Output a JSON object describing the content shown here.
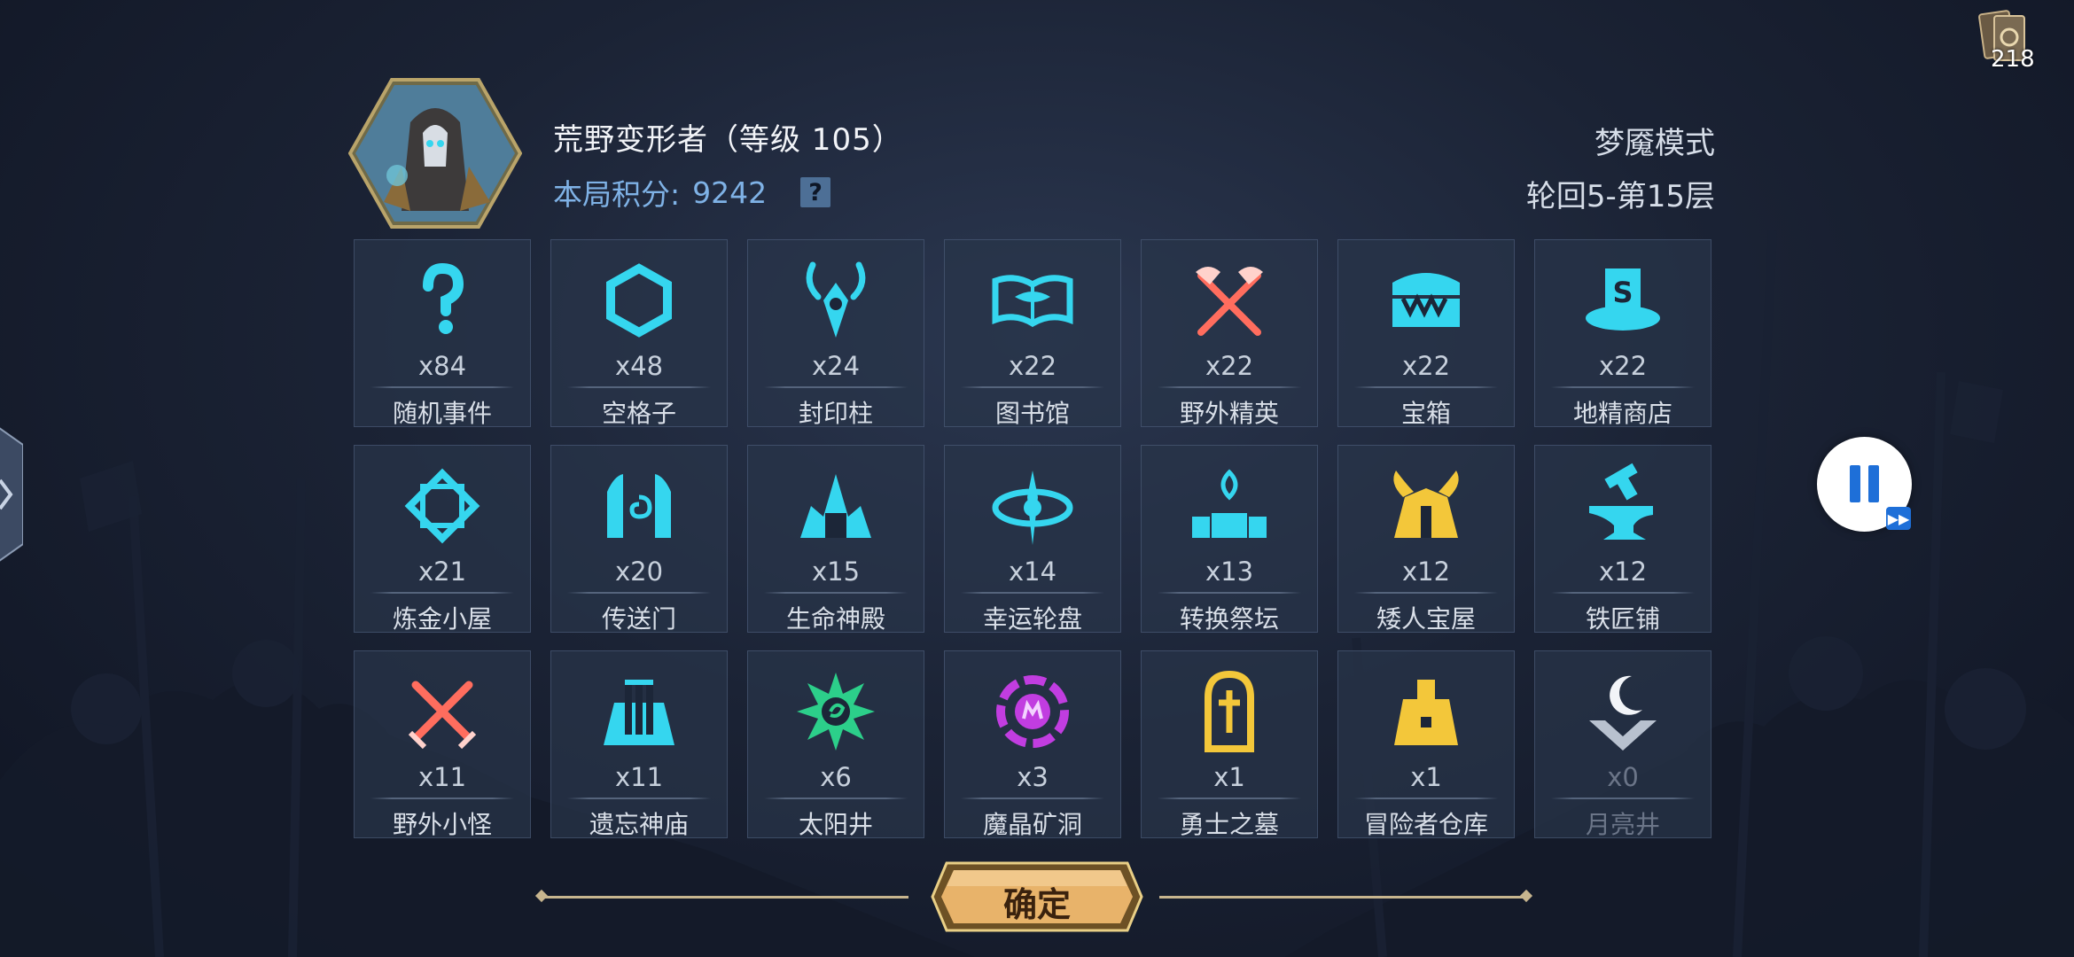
{
  "hero": {
    "name": "荒野变形者（等级 105）",
    "score_label": "本局积分:",
    "score_value": "9242",
    "help_symbol": "?"
  },
  "mode": {
    "title": "梦魇模式",
    "progress": "轮回5-第15层"
  },
  "deck": {
    "count": "218"
  },
  "colors": {
    "cyan": "#35d6ef",
    "gold": "#f3c73a",
    "red": "#ff6d5e",
    "purple": "#c13de0",
    "green": "#2ccf8a",
    "white": "#f2f4f8"
  },
  "tiles": [
    {
      "icon": "question-icon",
      "count": "x84",
      "label": "随机事件"
    },
    {
      "icon": "hexagon-icon",
      "count": "x48",
      "label": "空格子"
    },
    {
      "icon": "seal-pillar-icon",
      "count": "x24",
      "label": "封印柱"
    },
    {
      "icon": "open-book-icon",
      "count": "x22",
      "label": "图书馆"
    },
    {
      "icon": "crossed-axes-icon",
      "count": "x22",
      "label": "野外精英"
    },
    {
      "icon": "treasure-chest-icon",
      "count": "x22",
      "label": "宝箱"
    },
    {
      "icon": "goblin-shop-icon",
      "count": "x22",
      "label": "地精商店"
    },
    {
      "icon": "alchemy-hut-icon",
      "count": "x21",
      "label": "炼金小屋"
    },
    {
      "icon": "portal-icon",
      "count": "x20",
      "label": "传送门"
    },
    {
      "icon": "life-temple-icon",
      "count": "x15",
      "label": "生命神殿"
    },
    {
      "icon": "lucky-wheel-icon",
      "count": "x14",
      "label": "幸运轮盘"
    },
    {
      "icon": "transform-altar-icon",
      "count": "x13",
      "label": "转换祭坛"
    },
    {
      "icon": "dwarf-treasury-icon",
      "count": "x12",
      "label": "矮人宝屋"
    },
    {
      "icon": "anvil-icon",
      "count": "x12",
      "label": "铁匠铺"
    },
    {
      "icon": "crossed-swords-icon",
      "count": "x11",
      "label": "野外小怪"
    },
    {
      "icon": "forgotten-temple-icon",
      "count": "x11",
      "label": "遗忘神庙"
    },
    {
      "icon": "sun-well-icon",
      "count": "x6",
      "label": "太阳井"
    },
    {
      "icon": "crystal-mine-icon",
      "count": "x3",
      "label": "魔晶矿洞"
    },
    {
      "icon": "tombstone-icon",
      "count": "x1",
      "label": "勇士之墓"
    },
    {
      "icon": "adventurer-warehouse-icon",
      "count": "x1",
      "label": "冒险者仓库"
    },
    {
      "icon": "moon-well-icon",
      "count": "x0",
      "label": "月亮井"
    }
  ],
  "confirm": {
    "label": "确定"
  }
}
